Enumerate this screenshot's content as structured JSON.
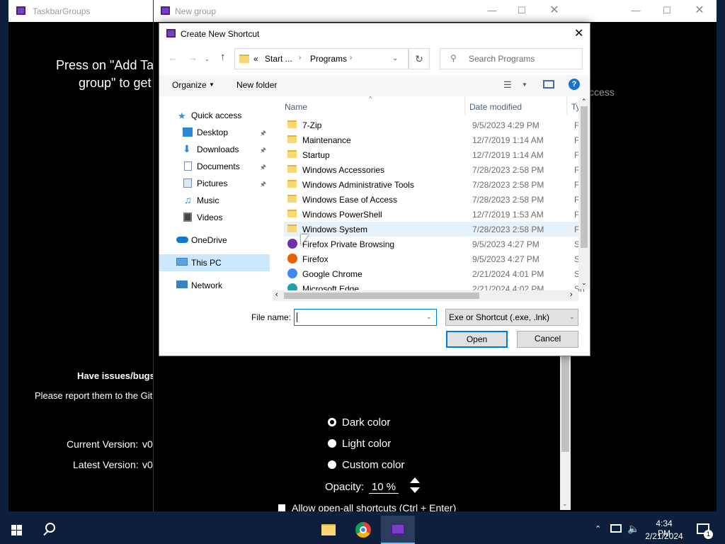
{
  "taskbarGroups": {
    "title": "TaskbarGroups",
    "intro": "Press on \"Add Ta",
    "intro2": "group\" to get st",
    "issues_heading": "Have issues/bugs",
    "issues_text": "Please report them to the Git",
    "current_version_label": "Current Version:",
    "current_version_value": "v0",
    "latest_version_label": "Latest Version:",
    "latest_version_value": "v0",
    "right_text": "ccess"
  },
  "newGroup": {
    "title": "New group",
    "colors": [
      "Dark color",
      "Light color",
      "Custom color"
    ],
    "opacity_label": "Opacity:",
    "opacity_value": "10 %",
    "allow_text": "Allow open-all shortcuts (Ctrl + Enter)"
  },
  "dialog": {
    "title": "Create New Shortcut",
    "breadcrumb": [
      "Start ...",
      "Programs"
    ],
    "breadcrumb_prefix": "«",
    "search_placeholder": "Search Programs",
    "organize": "Organize",
    "new_folder": "New folder",
    "nav": {
      "quick_access": "Quick access",
      "desktop": "Desktop",
      "downloads": "Downloads",
      "documents": "Documents",
      "pictures": "Pictures",
      "music": "Music",
      "videos": "Videos",
      "onedrive": "OneDrive",
      "this_pc": "This PC",
      "network": "Network"
    },
    "columns": {
      "name": "Name",
      "date": "Date modified",
      "type": "Ty"
    },
    "files": [
      {
        "name": "7-Zip",
        "date": "9/5/2023 4:29 PM",
        "type": "Fi",
        "kind": "folder"
      },
      {
        "name": "Maintenance",
        "date": "12/7/2019 1:14 AM",
        "type": "Fi",
        "kind": "folder"
      },
      {
        "name": "Startup",
        "date": "12/7/2019 1:14 AM",
        "type": "Fi",
        "kind": "folder"
      },
      {
        "name": "Windows Accessories",
        "date": "7/28/2023 2:58 PM",
        "type": "Fi",
        "kind": "folder"
      },
      {
        "name": "Windows Administrative Tools",
        "date": "7/28/2023 2:58 PM",
        "type": "Fi",
        "kind": "folder"
      },
      {
        "name": "Windows Ease of Access",
        "date": "7/28/2023 2:58 PM",
        "type": "Fi",
        "kind": "folder"
      },
      {
        "name": "Windows PowerShell",
        "date": "12/7/2019 1:53 AM",
        "type": "Fi",
        "kind": "folder"
      },
      {
        "name": "Windows System",
        "date": "7/28/2023 2:58 PM",
        "type": "Fi",
        "kind": "folder"
      },
      {
        "name": "Firefox Private Browsing",
        "date": "9/5/2023 4:27 PM",
        "type": "Sh",
        "kind": "firefox-private"
      },
      {
        "name": "Firefox",
        "date": "9/5/2023 4:27 PM",
        "type": "Sh",
        "kind": "firefox"
      },
      {
        "name": "Google Chrome",
        "date": "2/21/2024 4:01 PM",
        "type": "Sh",
        "kind": "chrome"
      },
      {
        "name": "Microsoft Edge",
        "date": "2/21/2024 4:02 PM",
        "type": "Sh",
        "kind": "edge"
      }
    ],
    "file_name_label": "File name:",
    "file_name_value": "",
    "filter": "Exe or Shortcut (.exe, .lnk)",
    "open": "Open",
    "cancel": "Cancel"
  },
  "taskbar": {
    "time": "4:34 PM",
    "date": "2/21/2024",
    "notification_count": "1"
  },
  "colors": {
    "accent": "#0078d7",
    "folder": "#f8d775",
    "app_purple": "#7b3fc6"
  }
}
